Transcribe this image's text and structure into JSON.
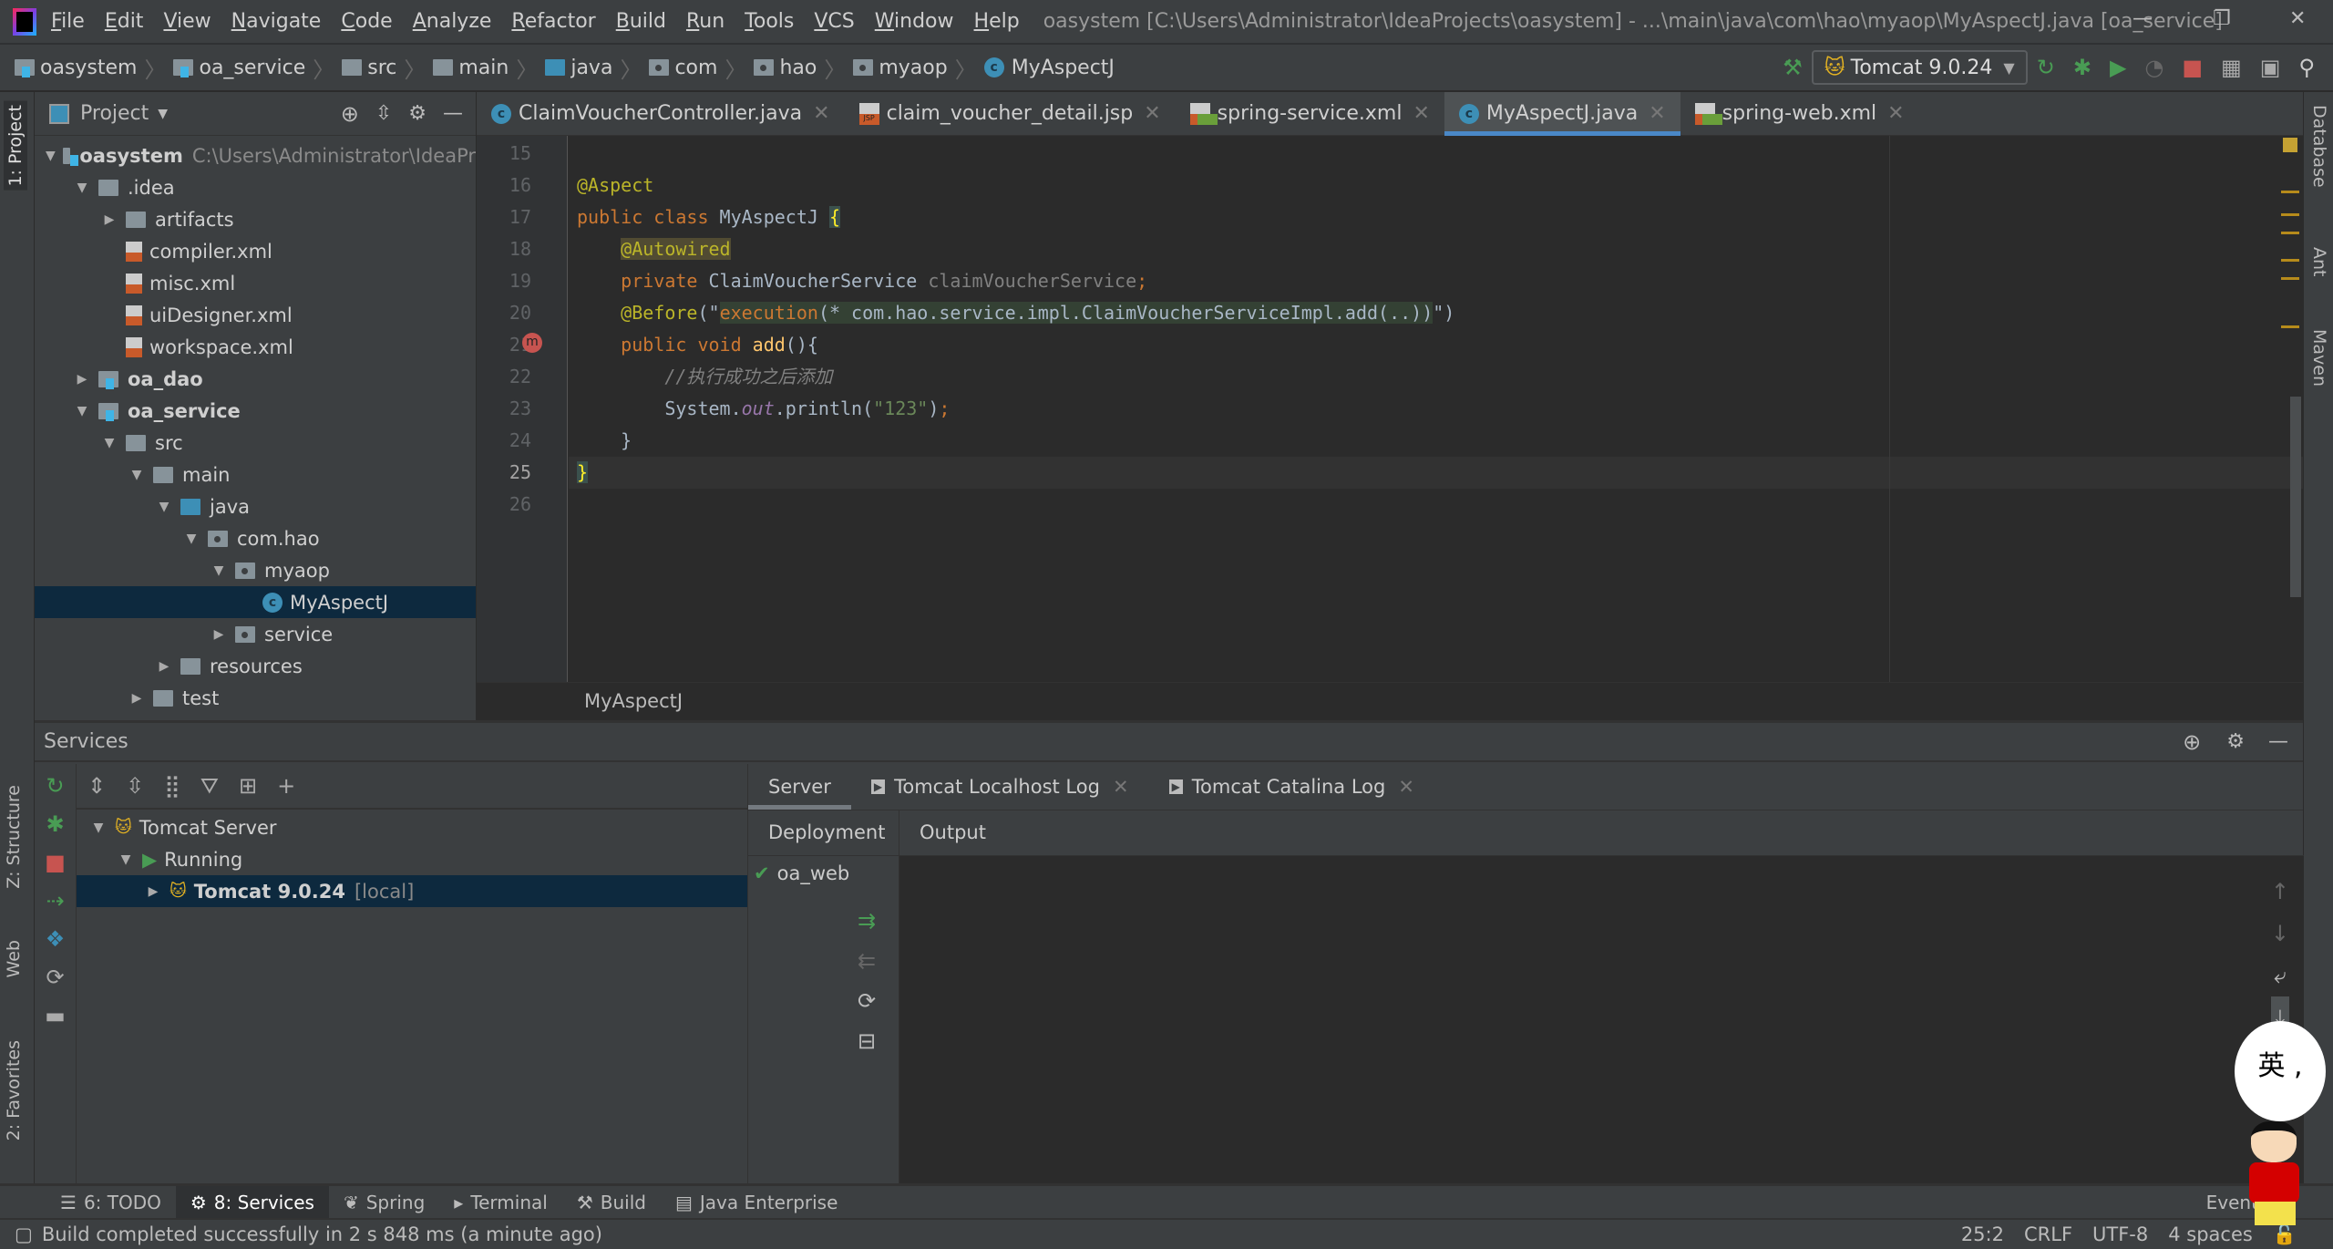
{
  "menu": {
    "items": [
      "File",
      "Edit",
      "View",
      "Navigate",
      "Code",
      "Analyze",
      "Refactor",
      "Build",
      "Run",
      "Tools",
      "VCS",
      "Window",
      "Help"
    ],
    "title": "oasystem [C:\\Users\\Administrator\\IdeaProjects\\oasystem] - ...\\main\\java\\com\\hao\\myaop\\MyAspectJ.java [oa_service]"
  },
  "breadcrumb": [
    {
      "label": "oasystem",
      "icon": "module-folder"
    },
    {
      "label": "oa_service",
      "icon": "module-folder"
    },
    {
      "label": "src",
      "icon": "folder"
    },
    {
      "label": "main",
      "icon": "folder"
    },
    {
      "label": "java",
      "icon": "source-folder"
    },
    {
      "label": "com",
      "icon": "package"
    },
    {
      "label": "hao",
      "icon": "package"
    },
    {
      "label": "myaop",
      "icon": "package"
    },
    {
      "label": "MyAspectJ",
      "icon": "class"
    }
  ],
  "toolbar": {
    "run_config": "Tomcat 9.0.24"
  },
  "left_stripe": {
    "project": "1: Project",
    "structure": "Z: Structure",
    "web": "Web",
    "favorites": "2: Favorites"
  },
  "right_stripe": {
    "database": "Database",
    "ant": "Ant",
    "maven": "Maven"
  },
  "project": {
    "title": "Project",
    "tree": [
      {
        "level": 0,
        "arrow": "open",
        "icon": "module",
        "label": "oasystem",
        "hint": "C:\\Users\\Administrator\\IdeaPr",
        "bold": true
      },
      {
        "level": 1,
        "arrow": "open",
        "icon": "folder",
        "label": ".idea"
      },
      {
        "level": 2,
        "arrow": "closed",
        "icon": "folder",
        "label": "artifacts"
      },
      {
        "level": 2,
        "arrow": "",
        "icon": "xml",
        "label": "compiler.xml"
      },
      {
        "level": 2,
        "arrow": "",
        "icon": "xml",
        "label": "misc.xml"
      },
      {
        "level": 2,
        "arrow": "",
        "icon": "xml",
        "label": "uiDesigner.xml"
      },
      {
        "level": 2,
        "arrow": "",
        "icon": "xml",
        "label": "workspace.xml"
      },
      {
        "level": 1,
        "arrow": "closed",
        "icon": "module",
        "label": "oa_dao",
        "bold": true
      },
      {
        "level": 1,
        "arrow": "open",
        "icon": "module",
        "label": "oa_service",
        "bold": true
      },
      {
        "level": 2,
        "arrow": "open",
        "icon": "folder",
        "label": "src"
      },
      {
        "level": 3,
        "arrow": "open",
        "icon": "folder",
        "label": "main"
      },
      {
        "level": 4,
        "arrow": "open",
        "icon": "source",
        "label": "java"
      },
      {
        "level": 5,
        "arrow": "open",
        "icon": "package",
        "label": "com.hao"
      },
      {
        "level": 6,
        "arrow": "open",
        "icon": "package",
        "label": "myaop"
      },
      {
        "level": 7,
        "arrow": "",
        "icon": "class",
        "label": "MyAspectJ",
        "selected": true
      },
      {
        "level": 6,
        "arrow": "closed",
        "icon": "package",
        "label": "service"
      },
      {
        "level": 4,
        "arrow": "closed",
        "icon": "resources",
        "label": "resources"
      },
      {
        "level": 3,
        "arrow": "closed",
        "icon": "folder",
        "label": "test"
      }
    ]
  },
  "tabs": [
    {
      "label": "ClaimVoucherController.java",
      "icon": "class"
    },
    {
      "label": "claim_voucher_detail.jsp",
      "icon": "jsp"
    },
    {
      "label": "spring-service.xml",
      "icon": "spring-xml"
    },
    {
      "label": "MyAspectJ.java",
      "icon": "class",
      "active": true
    },
    {
      "label": "spring-web.xml",
      "icon": "spring-xml"
    }
  ],
  "editor": {
    "current_line": 25,
    "lines": [
      {
        "n": 15,
        "tokens": []
      },
      {
        "n": 16,
        "tokens": [
          {
            "t": "@Aspect",
            "c": "a"
          }
        ]
      },
      {
        "n": 17,
        "tokens": [
          {
            "t": "public class ",
            "c": "k"
          },
          {
            "t": "MyAspectJ ",
            "c": "p"
          },
          {
            "t": "{",
            "c": "brace"
          }
        ]
      },
      {
        "n": 18,
        "tokens": [
          {
            "t": "    ",
            "c": "p"
          },
          {
            "t": "@Autowired",
            "c": "a hl1"
          }
        ]
      },
      {
        "n": 19,
        "tokens": [
          {
            "t": "    ",
            "c": "p"
          },
          {
            "t": "private ",
            "c": "k"
          },
          {
            "t": "ClaimVoucherService ",
            "c": "p"
          },
          {
            "t": "claimVoucherService",
            "c": "v"
          },
          {
            "t": ";",
            "c": "k"
          }
        ]
      },
      {
        "n": 20,
        "tokens": [
          {
            "t": "    ",
            "c": "p"
          },
          {
            "t": "@Before",
            "c": "a"
          },
          {
            "t": "(\"",
            "c": "p"
          },
          {
            "t": "execution",
            "c": "k hl2"
          },
          {
            "t": "(* com.hao.service.impl.ClaimVoucherServiceImpl.add(..))",
            "c": "p hl2"
          },
          {
            "t": "\")",
            "c": "p"
          }
        ]
      },
      {
        "n": 21,
        "tokens": [
          {
            "t": "    ",
            "c": "p"
          },
          {
            "t": "public void ",
            "c": "k"
          },
          {
            "t": "add",
            "c": "f"
          },
          {
            "t": "(){",
            "c": "p"
          }
        ]
      },
      {
        "n": 22,
        "tokens": [
          {
            "t": "        ",
            "c": "p"
          },
          {
            "t": "//执行成功之后添加",
            "c": "c"
          }
        ]
      },
      {
        "n": 23,
        "tokens": [
          {
            "t": "        System.",
            "c": "p"
          },
          {
            "t": "out",
            "c": "fi"
          },
          {
            "t": ".println(",
            "c": "p"
          },
          {
            "t": "\"123\"",
            "c": "s"
          },
          {
            "t": ")",
            "c": "p"
          },
          {
            "t": ";",
            "c": "k"
          }
        ]
      },
      {
        "n": 24,
        "tokens": [
          {
            "t": "    }",
            "c": "p"
          }
        ]
      },
      {
        "n": 25,
        "tokens": [
          {
            "t": "}",
            "c": "brace"
          }
        ]
      },
      {
        "n": 26,
        "tokens": []
      }
    ],
    "breadcrumb": "MyAspectJ"
  },
  "services": {
    "title": "Services",
    "tree": [
      {
        "level": 0,
        "arrow": "open",
        "icon": "tomcat",
        "label": "Tomcat Server"
      },
      {
        "level": 1,
        "arrow": "open",
        "icon": "run",
        "label": "Running"
      },
      {
        "level": 2,
        "arrow": "closed",
        "icon": "tomcat",
        "label": "Tomcat 9.0.24",
        "hint": "[local]",
        "bold": true,
        "selected": true
      }
    ],
    "tabs": [
      {
        "label": "Server",
        "active": true
      },
      {
        "label": "Tomcat Localhost Log",
        "icon": "console"
      },
      {
        "label": "Tomcat Catalina Log",
        "icon": "console"
      }
    ],
    "subtabs": [
      "Deployment",
      "Output"
    ],
    "deployments": [
      {
        "label": "oa_web",
        "status": "deployed"
      }
    ]
  },
  "bottom_tabs": [
    {
      "label": "6: TODO"
    },
    {
      "label": "8: Services",
      "active": true
    },
    {
      "label": "Spring"
    },
    {
      "label": "Terminal"
    },
    {
      "label": "Build"
    },
    {
      "label": "Java Enterprise"
    }
  ],
  "event_log": "Event Log",
  "status": {
    "message": "Build completed successfully in 2 s 848 ms (a minute ago)",
    "position": "25:2",
    "line_sep": "CRLF",
    "encoding": "UTF-8",
    "indent": "4 spaces"
  },
  "mascot": {
    "bubble": "英 ,"
  }
}
